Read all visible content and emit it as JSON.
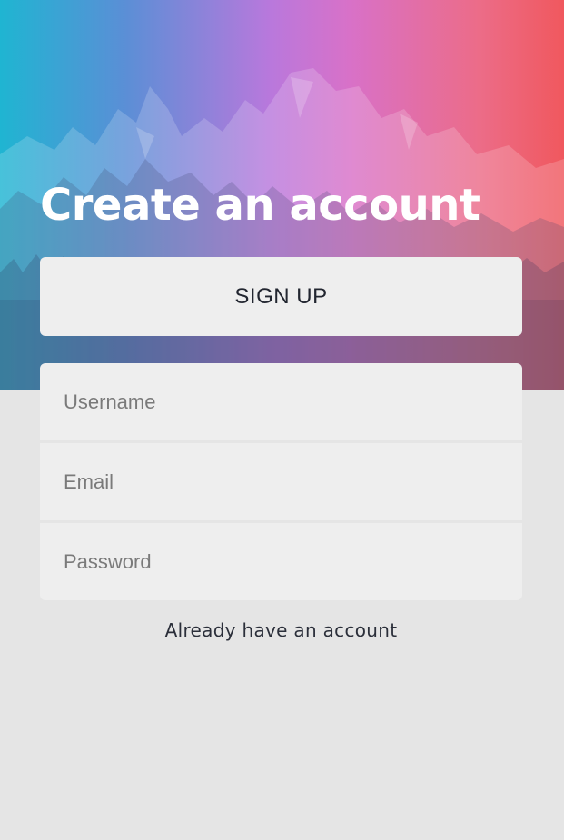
{
  "hero": {
    "title": "Create an account"
  },
  "signup_button": {
    "label": "SIGN UP"
  },
  "form": {
    "username_placeholder": "Username",
    "email_placeholder": "Email",
    "password_placeholder": "Password"
  },
  "login_link": {
    "label": "Already have an account"
  },
  "colors": {
    "gradient": [
      "#1fb5d2",
      "#b978dc",
      "#f0585e"
    ],
    "page_background": "#e5e5e5",
    "field_background": "#eeeeee",
    "text_dark": "#222630"
  }
}
